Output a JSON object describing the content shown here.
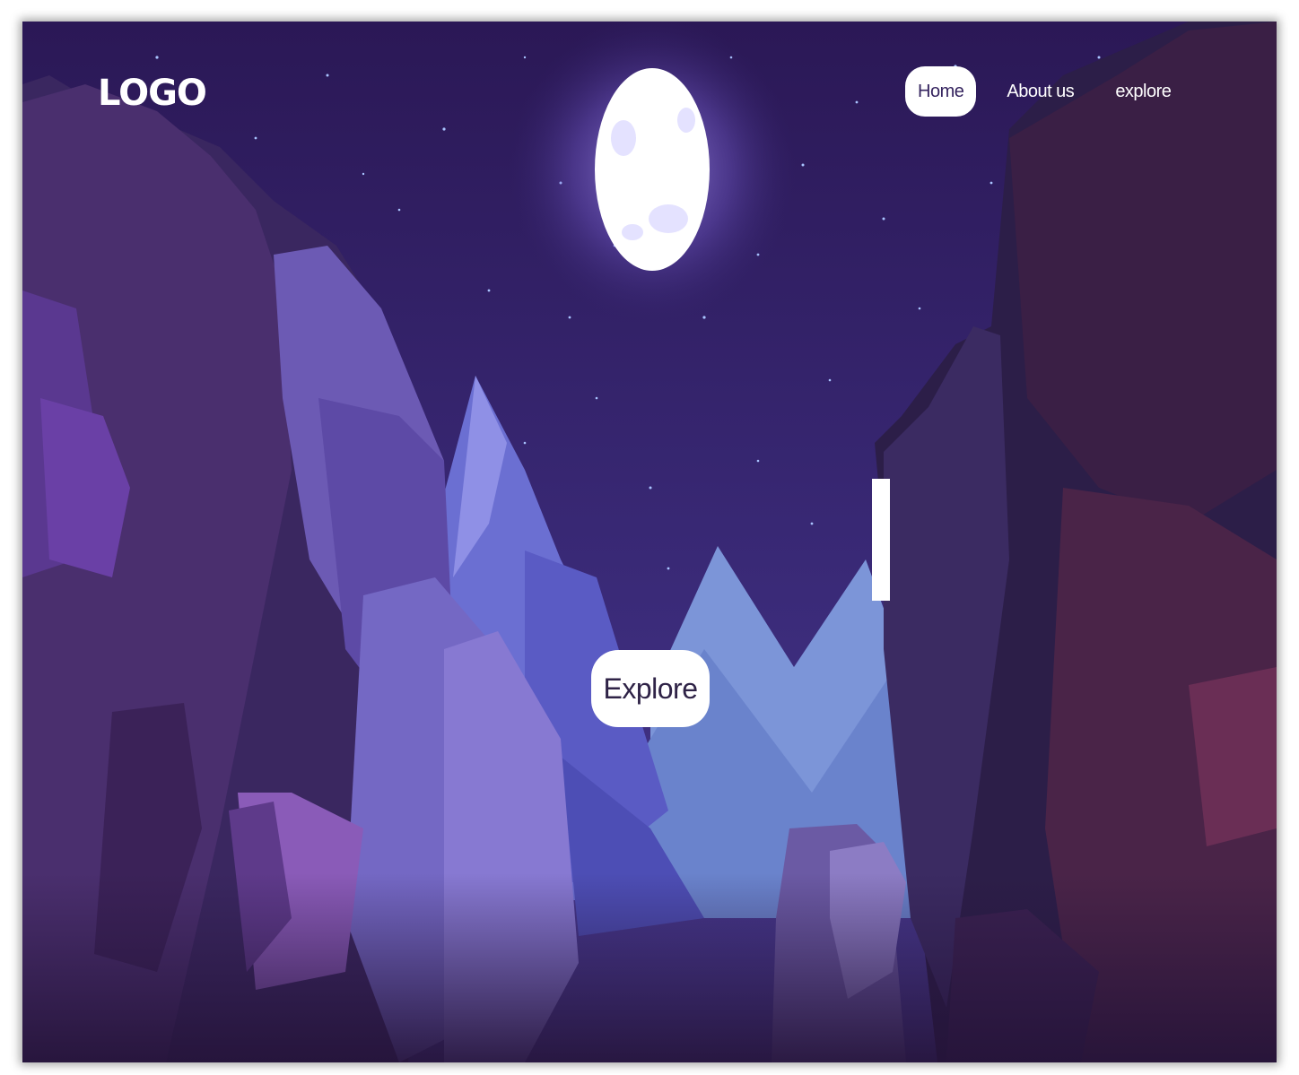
{
  "header": {
    "logo": "LOGO"
  },
  "nav": {
    "items": [
      {
        "label": "Home",
        "active": true
      },
      {
        "label": "About us",
        "active": false
      },
      {
        "label": "explore",
        "active": false
      }
    ]
  },
  "hero": {
    "cta_label": "Explore"
  },
  "colors": {
    "sky": "#2e1c5e",
    "moon": "#ffffff",
    "button_bg": "#ffffff",
    "button_text": "#35245f"
  }
}
